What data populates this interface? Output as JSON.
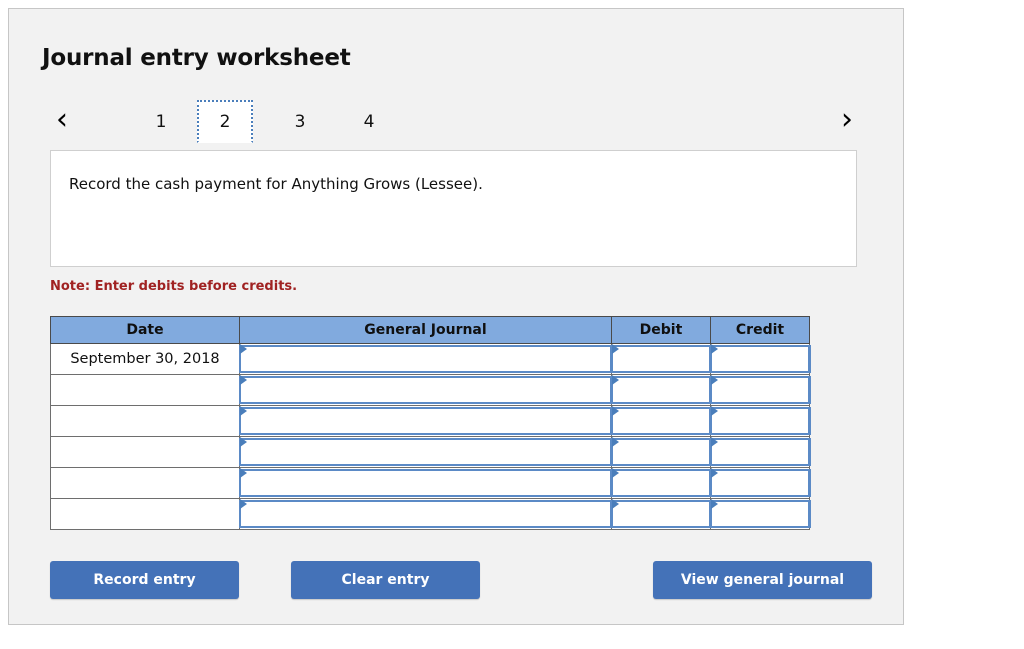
{
  "page_title": "Journal entry worksheet",
  "nav": {
    "prev_icon": "chevron-left-icon",
    "next_icon": "chevron-right-icon",
    "prev_label": "‹",
    "next_label": "›",
    "tabs": [
      {
        "label": "1",
        "active": false
      },
      {
        "label": "2",
        "active": true
      },
      {
        "label": "3",
        "active": false
      },
      {
        "label": "4",
        "active": false
      }
    ],
    "active_tab": "2"
  },
  "instruction": {
    "text": "Record the cash payment for Anything Grows (Lessee)."
  },
  "note": "Note: Enter debits before credits.",
  "table": {
    "headers": [
      "Date",
      "General Journal",
      "Debit",
      "Credit"
    ],
    "rows": [
      {
        "date": "September 30, 2018",
        "general_journal": "",
        "debit": "",
        "credit": ""
      },
      {
        "date": "",
        "general_journal": "",
        "debit": "",
        "credit": ""
      },
      {
        "date": "",
        "general_journal": "",
        "debit": "",
        "credit": ""
      },
      {
        "date": "",
        "general_journal": "",
        "debit": "",
        "credit": ""
      },
      {
        "date": "",
        "general_journal": "",
        "debit": "",
        "credit": ""
      },
      {
        "date": "",
        "general_journal": "",
        "debit": "",
        "credit": ""
      }
    ]
  },
  "buttons": {
    "record": "Record entry",
    "clear": "Clear entry",
    "view": "View general journal"
  },
  "colors": {
    "panel_background": "#f2f2f2",
    "header_blue": "#81aade",
    "button_blue": "#4472b8",
    "note_red": "#a02222",
    "cell_border_blue": "#5b8ac6",
    "active_tab_border": "#4a7ebb"
  }
}
